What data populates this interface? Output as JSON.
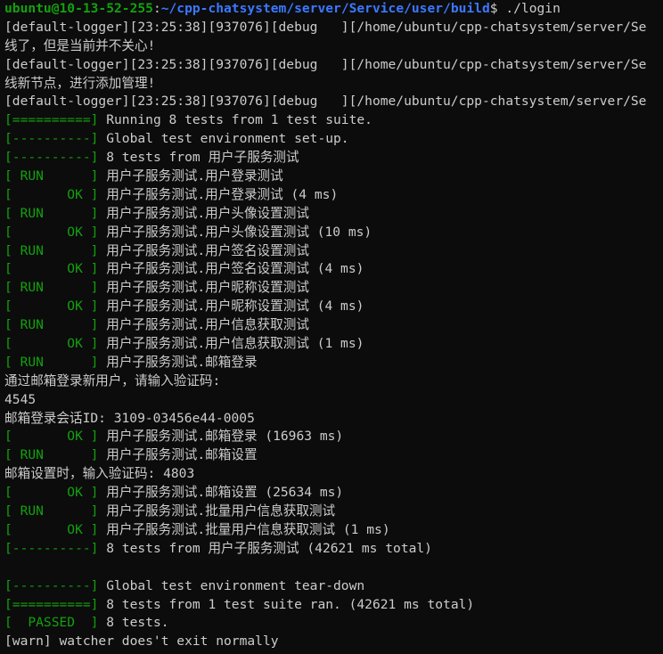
{
  "prompt": {
    "user_host": "ubuntu@10-13-52-255",
    "separator": ":",
    "path": "~/cpp-chatsystem/server/Service/user/build",
    "symbol": "$",
    "command": " ./login"
  },
  "lines": [
    {
      "tag": "",
      "text": "[default-logger][23:25:38][937076][debug   ][/home/ubuntu/cpp-chatsystem/server/Se"
    },
    {
      "tag": "",
      "text": "线了，但是当前并不关心!"
    },
    {
      "tag": "",
      "text": "[default-logger][23:25:38][937076][debug   ][/home/ubuntu/cpp-chatsystem/server/Se"
    },
    {
      "tag": "",
      "text": "线新节点，进行添加管理!"
    },
    {
      "tag": "",
      "text": "[default-logger][23:25:38][937076][debug   ][/home/ubuntu/cpp-chatsystem/server/Se"
    },
    {
      "tag": "[==========]",
      "text": " Running 8 tests from 1 test suite."
    },
    {
      "tag": "[----------]",
      "text": " Global test environment set-up."
    },
    {
      "tag": "[----------]",
      "text": " 8 tests from 用户子服务测试"
    },
    {
      "tag": "[ RUN      ]",
      "text": " 用户子服务测试.用户登录测试"
    },
    {
      "tag": "[       OK ]",
      "text": " 用户子服务测试.用户登录测试 (4 ms)"
    },
    {
      "tag": "[ RUN      ]",
      "text": " 用户子服务测试.用户头像设置测试"
    },
    {
      "tag": "[       OK ]",
      "text": " 用户子服务测试.用户头像设置测试 (10 ms)"
    },
    {
      "tag": "[ RUN      ]",
      "text": " 用户子服务测试.用户签名设置测试"
    },
    {
      "tag": "[       OK ]",
      "text": " 用户子服务测试.用户签名设置测试 (4 ms)"
    },
    {
      "tag": "[ RUN      ]",
      "text": " 用户子服务测试.用户昵称设置测试"
    },
    {
      "tag": "[       OK ]",
      "text": " 用户子服务测试.用户昵称设置测试 (4 ms)"
    },
    {
      "tag": "[ RUN      ]",
      "text": " 用户子服务测试.用户信息获取测试"
    },
    {
      "tag": "[       OK ]",
      "text": " 用户子服务测试.用户信息获取测试 (1 ms)"
    },
    {
      "tag": "[ RUN      ]",
      "text": " 用户子服务测试.邮箱登录"
    },
    {
      "tag": "",
      "text": "通过邮箱登录新用户，请输入验证码:"
    },
    {
      "tag": "",
      "text": "4545"
    },
    {
      "tag": "",
      "text": "邮箱登录会话ID: 3109-03456e44-0005"
    },
    {
      "tag": "[       OK ]",
      "text": " 用户子服务测试.邮箱登录 (16963 ms)"
    },
    {
      "tag": "[ RUN      ]",
      "text": " 用户子服务测试.邮箱设置"
    },
    {
      "tag": "",
      "text": "邮箱设置时，输入验证码: 4803"
    },
    {
      "tag": "[       OK ]",
      "text": " 用户子服务测试.邮箱设置 (25634 ms)"
    },
    {
      "tag": "[ RUN      ]",
      "text": " 用户子服务测试.批量用户信息获取测试"
    },
    {
      "tag": "[       OK ]",
      "text": " 用户子服务测试.批量用户信息获取测试 (1 ms)"
    },
    {
      "tag": "[----------]",
      "text": " 8 tests from 用户子服务测试 (42621 ms total)"
    },
    {
      "tag": "",
      "text": ""
    },
    {
      "tag": "[----------]",
      "text": " Global test environment tear-down"
    },
    {
      "tag": "[==========]",
      "text": " 8 tests from 1 test suite ran. (42621 ms total)"
    },
    {
      "tag": "[  PASSED  ]",
      "text": " 8 tests."
    },
    {
      "tag": "",
      "text": "[warn] watcher does't exit normally"
    }
  ],
  "colors": {
    "background": "#0c0c0c",
    "text": "#cccccc",
    "green": "#13a10e",
    "path_blue": "#3b78ff"
  }
}
